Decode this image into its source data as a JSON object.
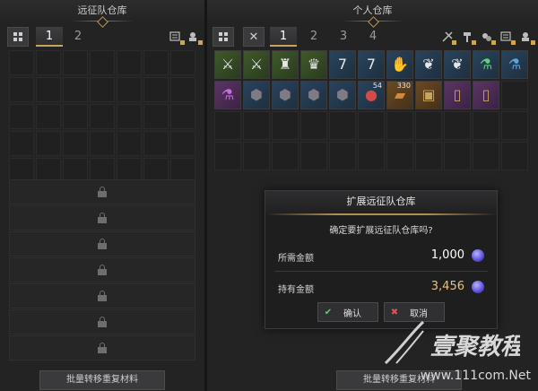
{
  "left_panel": {
    "title": "远征队仓库",
    "tabs": [
      "1",
      "2"
    ],
    "active_tab": "1",
    "bottom_button": "批量转移重复材料",
    "locked_rows": 7
  },
  "right_panel": {
    "title": "个人仓库",
    "tabs": [
      "1",
      "2",
      "3",
      "4"
    ],
    "active_tab": "1",
    "bottom_button": "批量转移重复材料",
    "items": [
      {
        "icon": "crossbow-icon",
        "rarity": "green"
      },
      {
        "icon": "crossbow-icon",
        "rarity": "green"
      },
      {
        "icon": "armor-set-icon",
        "rarity": "green"
      },
      {
        "icon": "robe-icon",
        "rarity": "green"
      },
      {
        "icon": "gloves-icon",
        "rarity": "blue"
      },
      {
        "icon": "gloves-icon",
        "rarity": "blue"
      },
      {
        "icon": "hand-icon",
        "rarity": "blue"
      },
      {
        "icon": "wing-icon",
        "rarity": "blue"
      },
      {
        "icon": "wing-icon",
        "rarity": "blue"
      },
      {
        "icon": "potion-green-icon",
        "rarity": "blue"
      },
      {
        "icon": "potion-blue-icon",
        "rarity": "blue"
      },
      {
        "icon": "potion-purple-icon",
        "rarity": "purple"
      },
      {
        "icon": "ore-icon",
        "rarity": "blue"
      },
      {
        "icon": "ore-icon",
        "rarity": "blue"
      },
      {
        "icon": "ore-icon",
        "rarity": "blue"
      },
      {
        "icon": "ore-icon",
        "rarity": "blue"
      },
      {
        "icon": "gem-red-icon",
        "rarity": "blue",
        "quantity": "54"
      },
      {
        "icon": "bread-icon",
        "rarity": "orange",
        "quantity": "330"
      },
      {
        "icon": "chest-icon",
        "rarity": "orange"
      },
      {
        "icon": "card-icon",
        "rarity": "purple"
      },
      {
        "icon": "card-icon",
        "rarity": "purple"
      }
    ]
  },
  "dialog": {
    "title": "扩展远征队仓库",
    "question": "确定要扩展远征队仓库吗?",
    "required_label": "所需金额",
    "required_value": "1,000",
    "owned_label": "持有金额",
    "owned_value": "3,456",
    "confirm_label": "确认",
    "cancel_label": "取消"
  },
  "watermark": {
    "logo_text": "壹聚教程",
    "url": "www.111com.Net"
  }
}
